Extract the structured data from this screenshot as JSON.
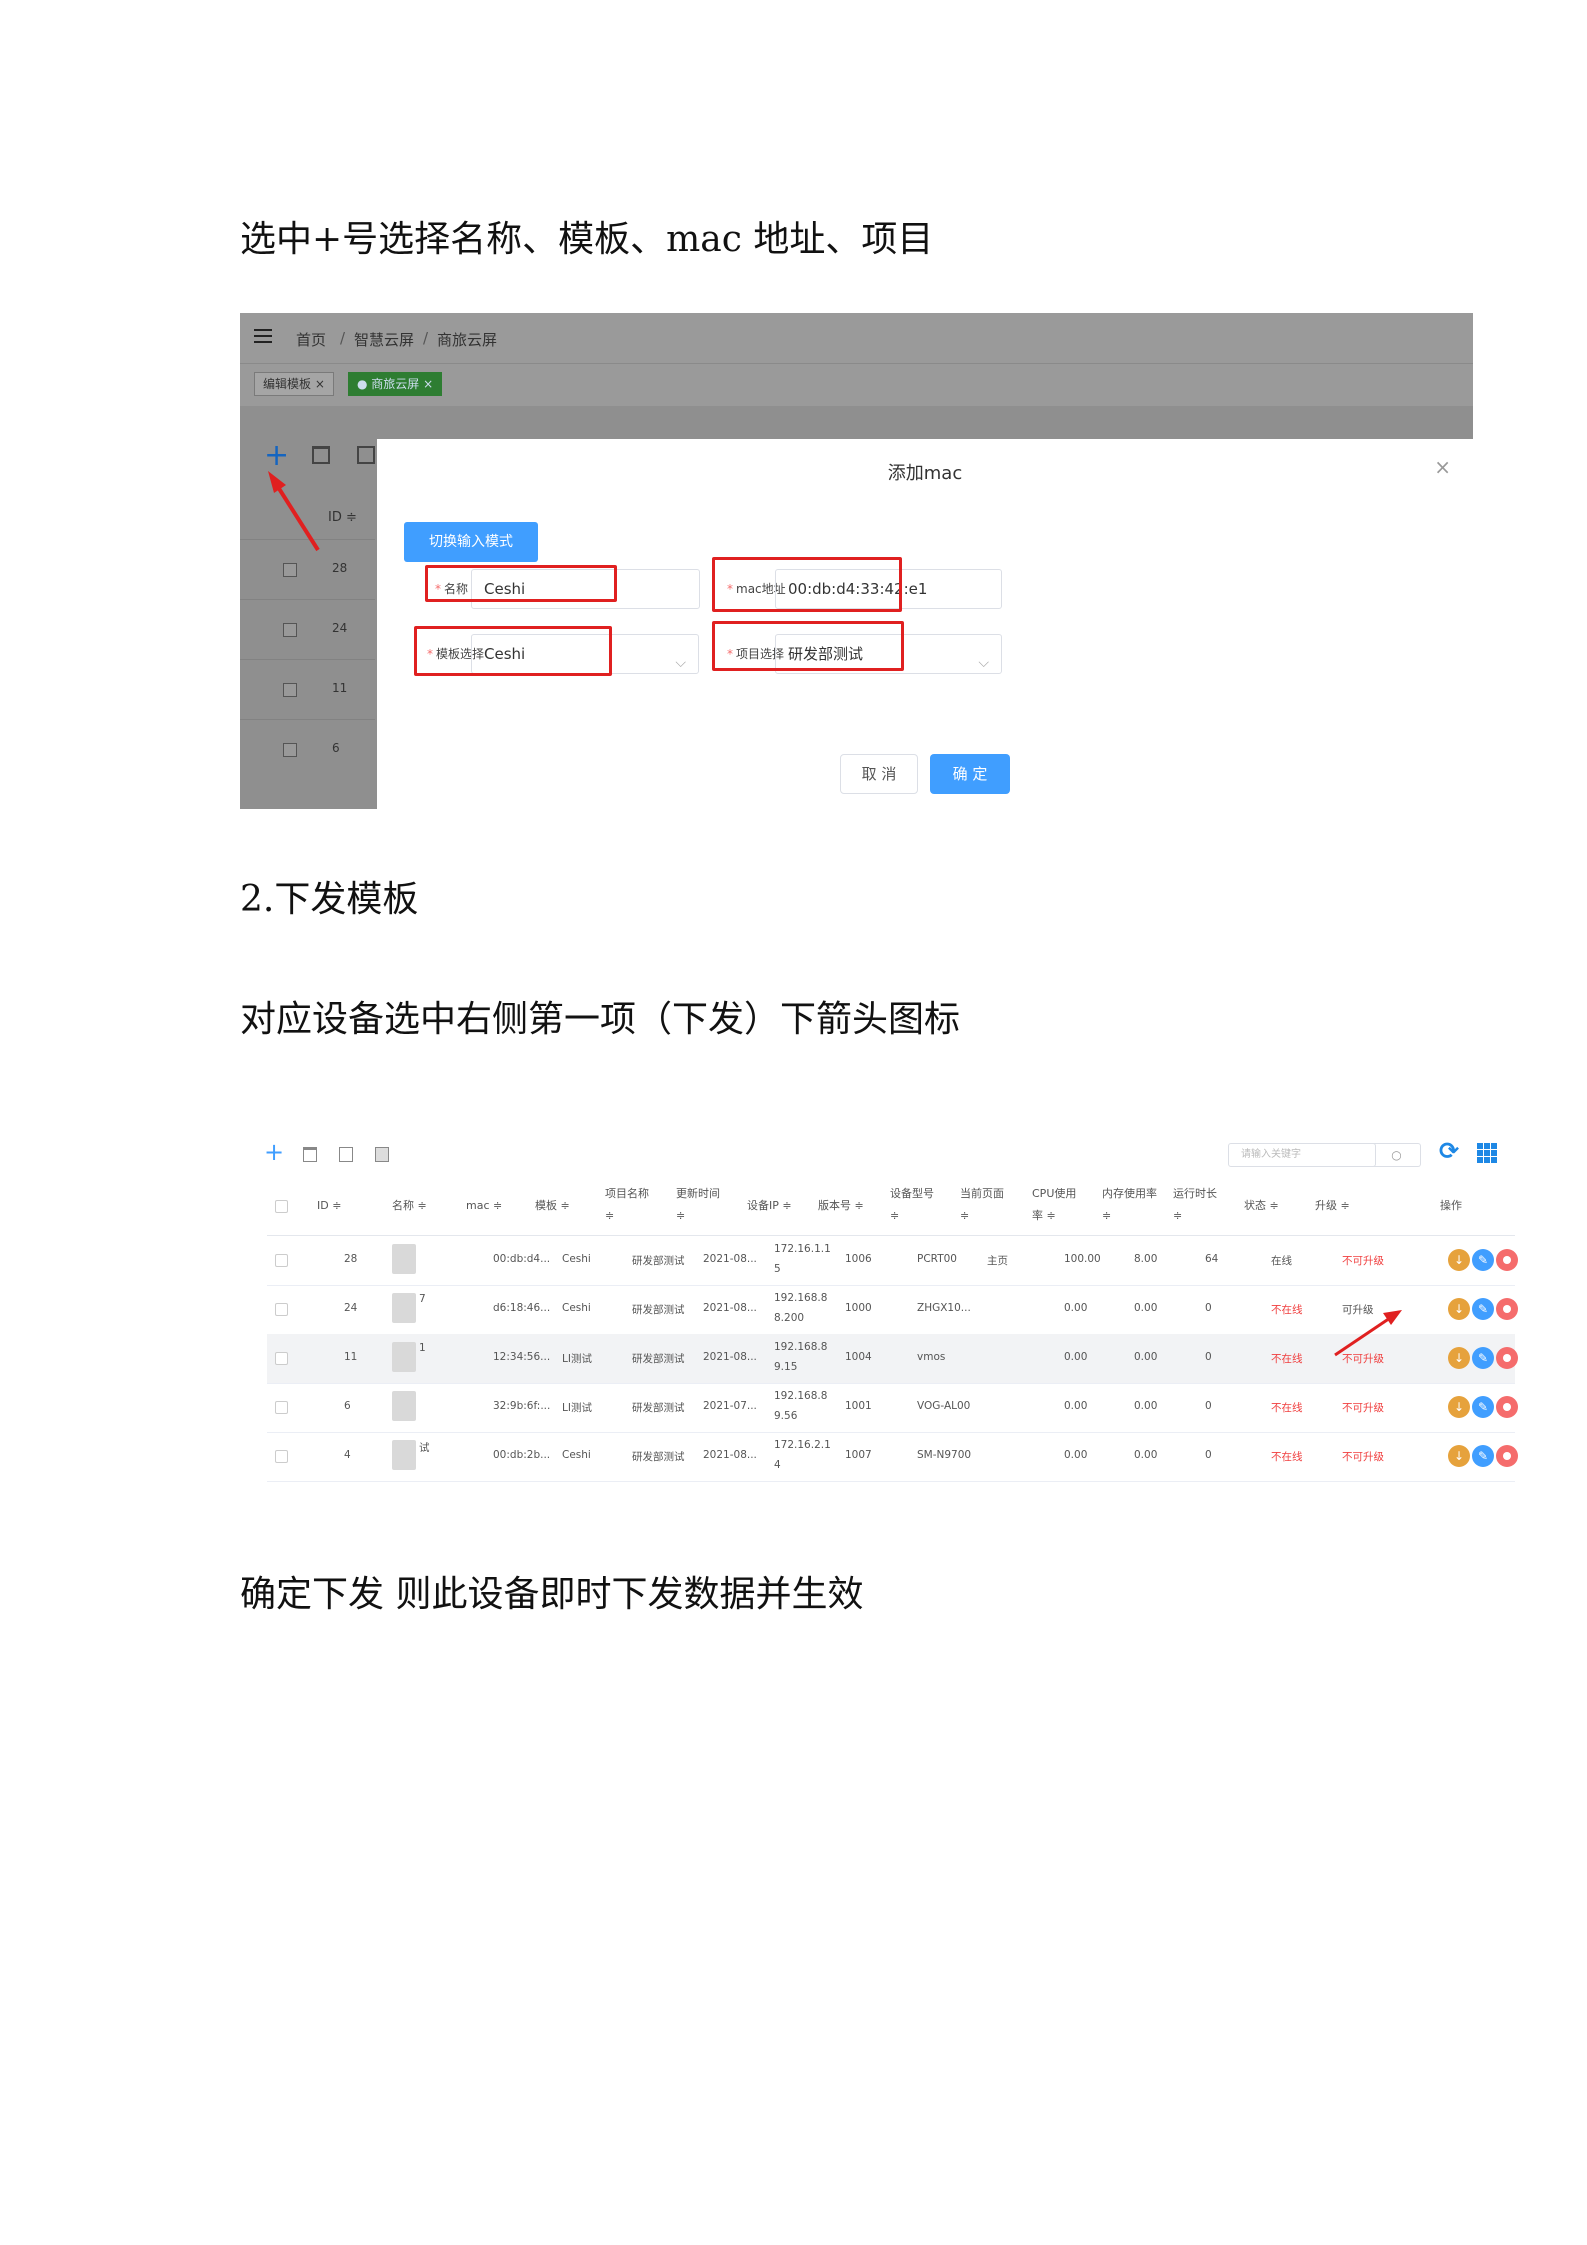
{
  "paragraphs": {
    "p1": "选中+号选择名称、模板、mac 地址、项目",
    "p2": "2.下发模板",
    "p3": "对应设备选中右侧第一项（下发）下箭头图标",
    "p4": "确定下发 则此设备即时下发数据并生效"
  },
  "shot1": {
    "breadcrumb": [
      "首页",
      "智慧云屏",
      "商旅云屏"
    ],
    "breadcrumb_sep": "/",
    "tabs": [
      {
        "label": "编辑模板",
        "close": "×"
      },
      {
        "label": "● 商旅云屏",
        "close": "×"
      }
    ],
    "bg_table": {
      "id_header": "ID ≑",
      "rows": [
        "28",
        "24",
        "11",
        "6"
      ]
    },
    "modal": {
      "title": "添加mac",
      "close": "×",
      "switch_button": "切换输入模式",
      "required_mark": "*",
      "name_label": "名称",
      "name_value": "Ceshi",
      "mac_label": "mac地址",
      "mac_value": "00:db:d4:33:42:e1",
      "template_label": "模板选择",
      "template_value": "Ceshi",
      "project_label": "项目选择",
      "project_value": "研发部测试",
      "cancel": "取 消",
      "confirm": "确 定"
    }
  },
  "shot2": {
    "search_placeholder": "请输入关键字",
    "search_icon": "○",
    "refresh_icon": "⟳",
    "headers": {
      "id": "ID ≑",
      "name": "名称 ≑",
      "mac": "mac ≑",
      "template": "模板 ≑",
      "project_1": "项目名称",
      "project_2": "≑",
      "time_1": "更新时间",
      "time_2": "≑",
      "ip": "设备IP ≑",
      "version": "版本号 ≑",
      "model_1": "设备型号",
      "model_2": "≑",
      "page_1": "当前页面",
      "page_2": "≑",
      "cpu_1": "CPU使用",
      "cpu_2": "率 ≑",
      "mem_1": "内存使用率",
      "mem_2": "≑",
      "runtime_1": "运行时长",
      "runtime_2": "≑",
      "status": "状态 ≑",
      "upgrade": "升级 ≑",
      "ops": "操作"
    },
    "rows": [
      {
        "id": "28",
        "name": "",
        "mac": "00:db:d4...",
        "template": "Ceshi",
        "project": "研发部测试",
        "time": "2021-08...",
        "ip": "172.16.1.1 5",
        "version": "1006",
        "model": "PCRT00",
        "page": "主页",
        "cpu": "100.00",
        "mem": "8.00",
        "runtime": "64",
        "status": "在线",
        "upgrade": "不可升级"
      },
      {
        "id": "24",
        "name": "7",
        "mac": "d6:18:46...",
        "template": "Ceshi",
        "project": "研发部测试",
        "time": "2021-08...",
        "ip": "192.168.8 8.200",
        "version": "1000",
        "model": "ZHGX10...",
        "page": "",
        "cpu": "0.00",
        "mem": "0.00",
        "runtime": "0",
        "status": "不在线",
        "upgrade": "可升级"
      },
      {
        "id": "11",
        "name": "1",
        "mac": "12:34:56...",
        "template": "LI测试",
        "project": "研发部测试",
        "time": "2021-08...",
        "ip": "192.168.8 9.15",
        "version": "1004",
        "model": "vmos",
        "page": "",
        "cpu": "0.00",
        "mem": "0.00",
        "runtime": "0",
        "status": "不在线",
        "upgrade": "不可升级"
      },
      {
        "id": "6",
        "name": "",
        "mac": "32:9b:6f:...",
        "template": "LI测试",
        "project": "研发部测试",
        "time": "2021-07...",
        "ip": "192.168.8 9.56",
        "version": "1001",
        "model": "VOG-AL00",
        "page": "",
        "cpu": "0.00",
        "mem": "0.00",
        "runtime": "0",
        "status": "不在线",
        "upgrade": "不可升级"
      },
      {
        "id": "4",
        "name": "试",
        "mac": "00:db:2b...",
        "template": "Ceshi",
        "project": "研发部测试",
        "time": "2021-08...",
        "ip": "172.16.2.1 4",
        "version": "1007",
        "model": "SM-N9700",
        "page": "",
        "cpu": "0.00",
        "mem": "0.00",
        "runtime": "0",
        "status": "不在线",
        "upgrade": "不可升级"
      }
    ]
  },
  "colors": {
    "primary": "#409eff",
    "annotation_red": "#e02020",
    "download_orange": "#e6a23c",
    "delete_red": "#f56c6c",
    "offline_red": "#f04040"
  }
}
